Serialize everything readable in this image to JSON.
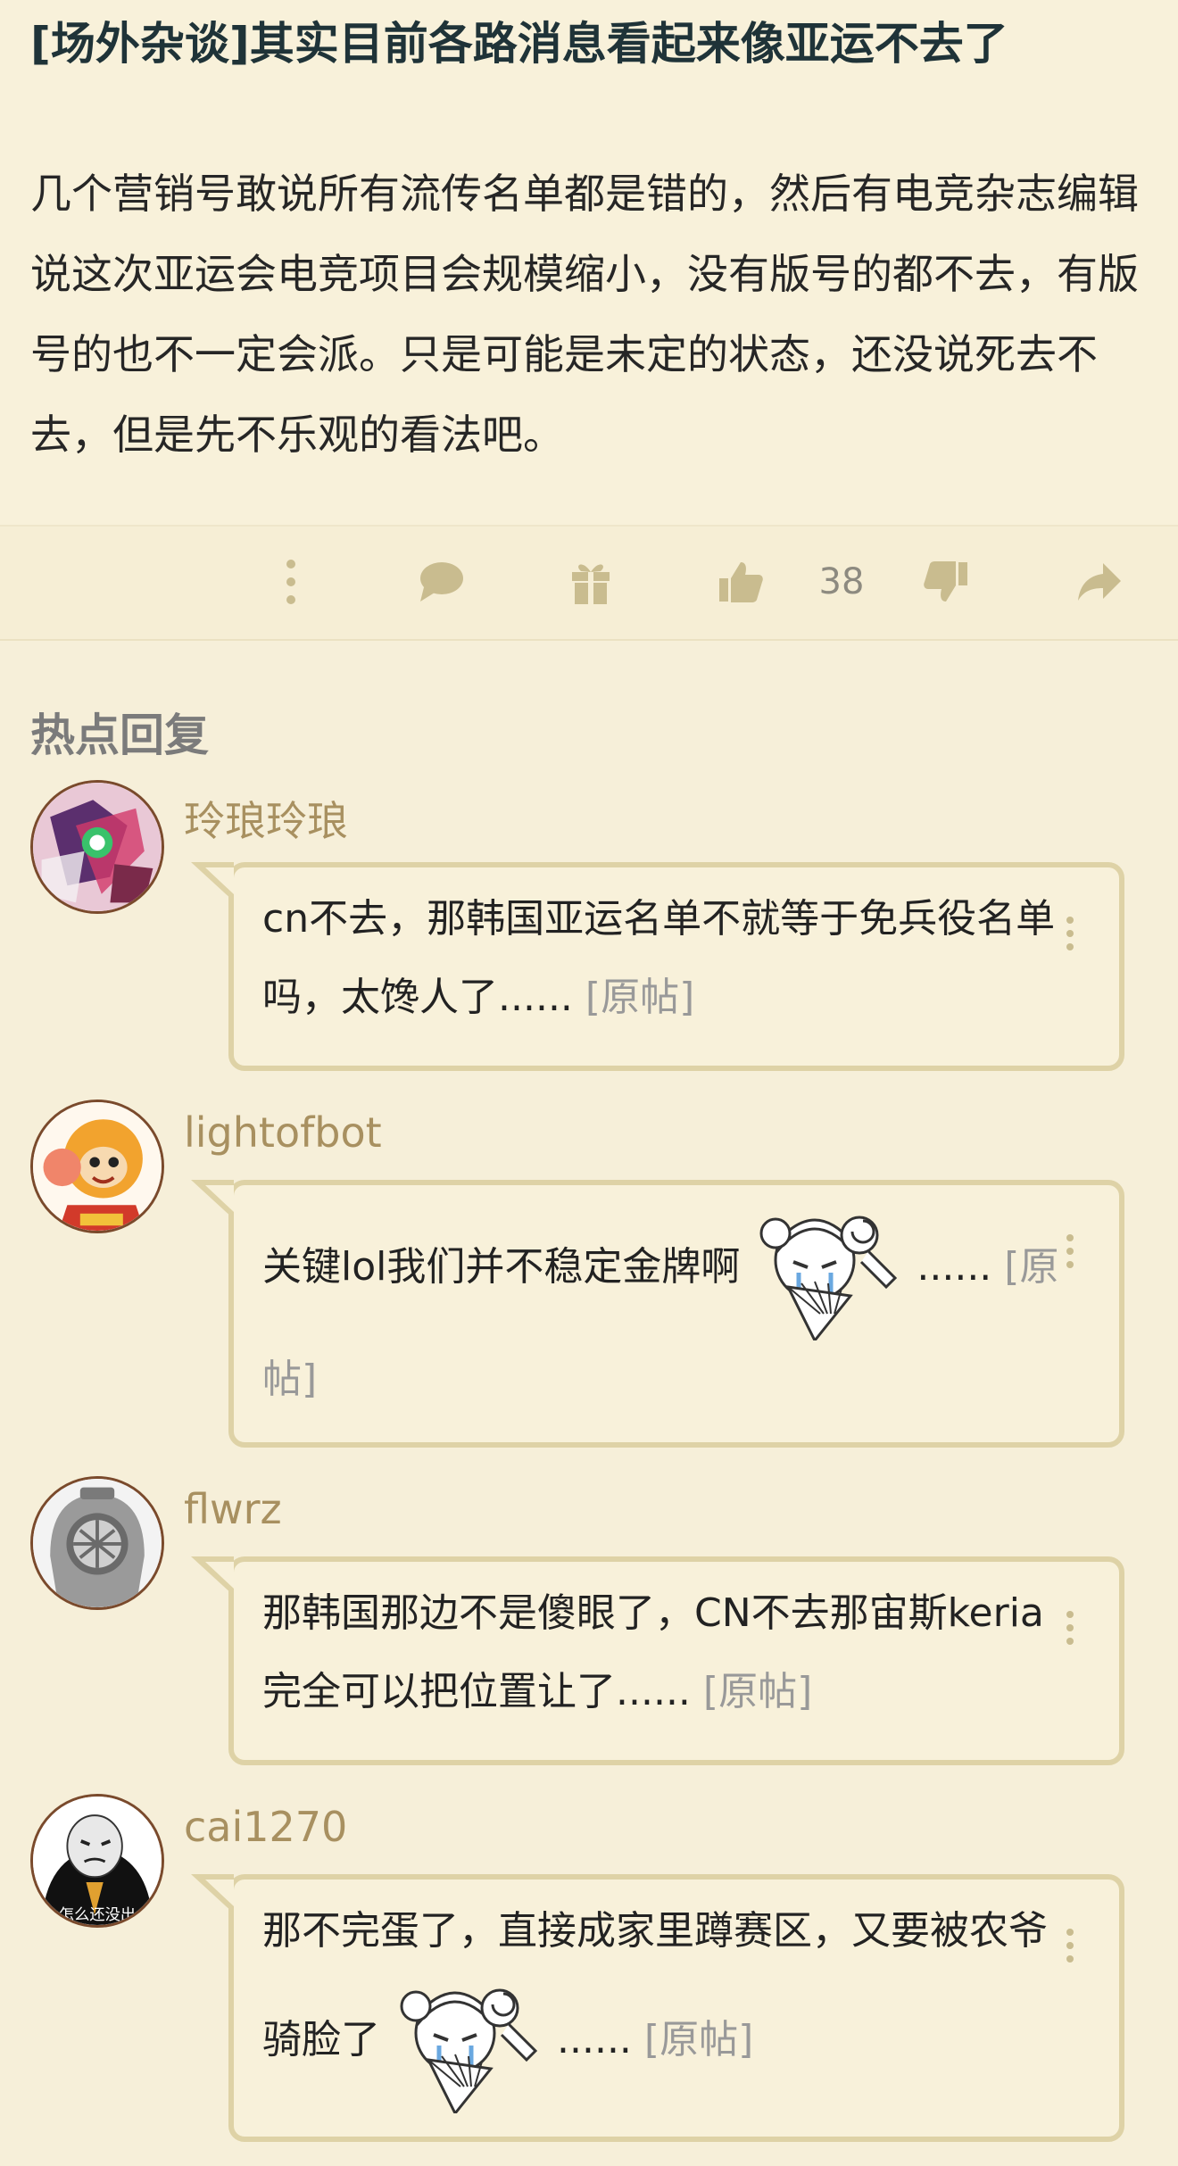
{
  "post": {
    "title": "[场外杂谈]其实目前各路消息看起来像亚运不去了",
    "body": "几个营销号敢说所有流传名单都是错的，然后有电竞杂志编辑说这次亚运会电竞项目会规模缩小，没有版号的都不去，有版号的也不一定会派。只是可能是未定的状态，还没说死去不去，但是先不乐观的看法吧。"
  },
  "toolbar": {
    "icons": [
      "more-vertical-icon",
      "comment-icon",
      "gift-icon",
      "thumbs-up-icon",
      "thumbs-down-icon",
      "share-icon"
    ],
    "like_count": "38"
  },
  "section": {
    "title": "热点回复"
  },
  "replies": [
    {
      "username": "玲琅玲琅",
      "text": "cn不去，那韩国亚运名单不就等于免兵役名单吗，太馋人了......",
      "source": "[原帖]"
    },
    {
      "username": "lightofbot",
      "text": "关键lol我们并不稳定金牌啊",
      "suffix": "......",
      "source": "[原帖]"
    },
    {
      "username": "flwrz",
      "text": "那韩国那边不是傻眼了，CN不去那宙斯keria完全可以把位置让了......",
      "source": "[原帖]"
    },
    {
      "username": "cai1270",
      "text": "那不完蛋了，直接成家里蹲赛区，又要被农爷骑脸了",
      "suffix": "......",
      "source": "[原帖]"
    }
  ],
  "avatar4_caption": "怎么还没出",
  "colors": {
    "background": "#f6efd9",
    "bubble_border": "#ded2a6",
    "username": "#a89060",
    "icon": "#c9bc8f"
  }
}
